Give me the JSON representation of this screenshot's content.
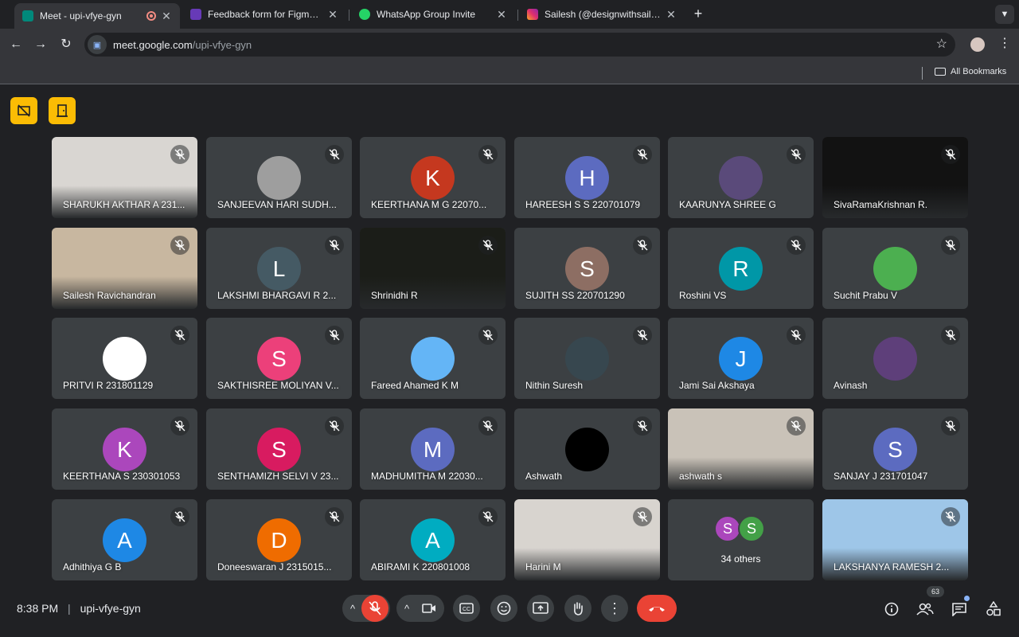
{
  "browser": {
    "tabs": [
      {
        "title": "Meet - upi-vfye-gyn",
        "favicon_color": "#00897b"
      },
      {
        "title": "Feedback form for Figma Eve",
        "favicon_color": "#673ab7"
      },
      {
        "title": "WhatsApp Group Invite",
        "favicon_color": "#25d366"
      },
      {
        "title": "Sailesh (@designwithsail) • In",
        "favicon_color": "#e1306c"
      }
    ],
    "url_host": "meet.google.com",
    "url_path": "/upi-vfye-gyn",
    "bookmarks_label": "All Bookmarks"
  },
  "participants": [
    {
      "name": "SHARUKH AKTHAR A 231...",
      "type": "video",
      "bg": "#d9d6d2"
    },
    {
      "name": "SANJEEVAN HARI SUDH...",
      "type": "photo",
      "color": "#9e9e9e",
      "initial": ""
    },
    {
      "name": "KEERTHANA M G 22070...",
      "type": "initial",
      "initial": "K",
      "color": "#c5381f"
    },
    {
      "name": "HAREESH S S 220701079",
      "type": "initial",
      "initial": "H",
      "color": "#5c6bc0"
    },
    {
      "name": "KAARUNYA SHREE G",
      "type": "photo",
      "color": "#5a4a7a",
      "initial": ""
    },
    {
      "name": "SivaRamaKrishnan R.",
      "type": "video",
      "bg": "#121212"
    },
    {
      "name": "Sailesh Ravichandran",
      "type": "video",
      "bg": "#c8b7a0"
    },
    {
      "name": "LAKSHMI BHARGAVI R 2...",
      "type": "initial",
      "initial": "L",
      "color": "#455a64"
    },
    {
      "name": "Shrinidhi R",
      "type": "video",
      "bg": "#1b1d18"
    },
    {
      "name": "SUJITH SS 220701290",
      "type": "initial",
      "initial": "S",
      "color": "#8d6e63"
    },
    {
      "name": "Roshini VS",
      "type": "initial",
      "initial": "R",
      "color": "#0097a7"
    },
    {
      "name": "Suchit Prabu V",
      "type": "photo",
      "color": "#4caf50",
      "initial": ""
    },
    {
      "name": "PRITVI R 231801129",
      "type": "photo",
      "color": "#ffffff",
      "initial": ""
    },
    {
      "name": "SAKTHISREE MOLIYAN V...",
      "type": "initial",
      "initial": "S",
      "color": "#ec407a"
    },
    {
      "name": "Fareed Ahamed K M",
      "type": "photo",
      "color": "#64b5f6",
      "initial": ""
    },
    {
      "name": "Nithin Suresh",
      "type": "photo",
      "color": "#37474f",
      "initial": ""
    },
    {
      "name": "Jami Sai Akshaya",
      "type": "initial",
      "initial": "J",
      "color": "#1e88e5"
    },
    {
      "name": "Avinash",
      "type": "photo",
      "color": "#5e3f7a",
      "initial": ""
    },
    {
      "name": "KEERTHANA S 230301053",
      "type": "initial",
      "initial": "K",
      "color": "#ab47bc"
    },
    {
      "name": "SENTHAMIZH SELVI V 23...",
      "type": "initial",
      "initial": "S",
      "color": "#d81b60"
    },
    {
      "name": "MADHUMITHA M 22030...",
      "type": "initial",
      "initial": "M",
      "color": "#5c6bc0"
    },
    {
      "name": "Ashwath",
      "type": "photo",
      "color": "#000000",
      "initial": ""
    },
    {
      "name": "ashwath s",
      "type": "video",
      "bg": "#c9c2b8"
    },
    {
      "name": "SANJAY J 231701047",
      "type": "initial",
      "initial": "S",
      "color": "#5c6bc0"
    },
    {
      "name": "Adhithiya G B",
      "type": "initial",
      "initial": "A",
      "color": "#1e88e5"
    },
    {
      "name": "Doneeswaran J 2315015...",
      "type": "initial",
      "initial": "D",
      "color": "#ef6c00"
    },
    {
      "name": "ABIRAMI K 220801008",
      "type": "initial",
      "initial": "A",
      "color": "#00acc1"
    },
    {
      "name": "Harini M",
      "type": "video",
      "bg": "#d8d4cf"
    },
    {
      "name": "34 others",
      "type": "others",
      "initials": [
        "S",
        "S"
      ],
      "colors": [
        "#ab47bc",
        "#43a047"
      ]
    },
    {
      "name": "LAKSHANYA RAMESH 2...",
      "type": "video",
      "bg": "#9ec6e8"
    }
  ],
  "footer": {
    "time": "8:38 PM",
    "separator": "|",
    "meeting_code": "upi-vfye-gyn",
    "participant_count": "63"
  },
  "colors": {
    "end_call": "#ea4335",
    "mic_muted": "#ea4335",
    "highlight_btn": "#fbbc04"
  }
}
